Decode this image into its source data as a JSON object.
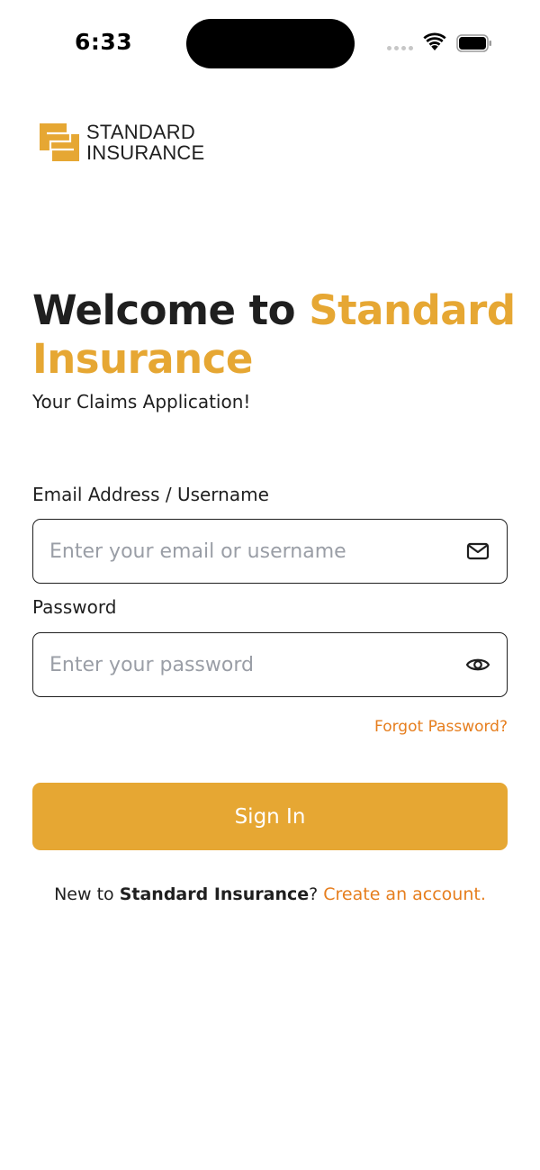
{
  "status_bar": {
    "time": "6:33"
  },
  "logo": {
    "line1": "STANDARD",
    "line2": "INSURANCE",
    "color": "#E6A733"
  },
  "welcome": {
    "heading_prefix": "Welcome to ",
    "heading_accent": "Standard Insurance",
    "subtitle": "Your Claims Application!"
  },
  "form": {
    "email": {
      "label": "Email Address / Username",
      "placeholder": "Enter your email or username",
      "value": "",
      "icon": "mail-icon"
    },
    "password": {
      "label": "Password",
      "placeholder": "Enter your password",
      "value": "",
      "icon": "eye-icon"
    },
    "forgot_label": "Forgot Password?",
    "signin_label": "Sign In"
  },
  "signup": {
    "prefix": "New to ",
    "brand": "Standard Insurance",
    "question": "? ",
    "link": "Create an account."
  },
  "colors": {
    "accent": "#E6A733",
    "link": "#E67E1E",
    "text": "#1f1f1f"
  }
}
